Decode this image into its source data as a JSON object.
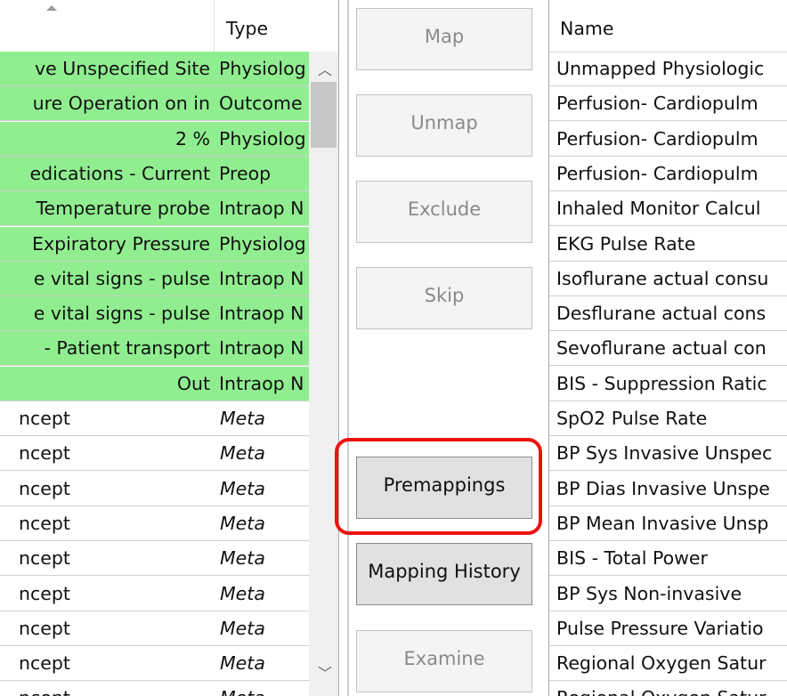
{
  "left_grid": {
    "header": {
      "type_label": "Type"
    },
    "rows": [
      {
        "name": "ve Unspecified Site",
        "type": "Physiolog",
        "mapped": true
      },
      {
        "name": "ure Operation on in",
        "type": "Outcome",
        "mapped": true
      },
      {
        "name": "2 %",
        "type": "Physiolog",
        "mapped": true
      },
      {
        "name": "edications - Current",
        "type": "Preop",
        "mapped": true
      },
      {
        "name": " Temperature probe",
        "type": "Intraop N",
        "mapped": true
      },
      {
        "name": " Expiratory Pressure",
        "type": "Physiolog",
        "mapped": true
      },
      {
        "name": "e vital signs - pulse",
        "type": "Intraop N",
        "mapped": true
      },
      {
        "name": "e vital signs - pulse",
        "type": "Intraop N",
        "mapped": true
      },
      {
        "name": " - Patient transport",
        "type": "Intraop N",
        "mapped": true
      },
      {
        "name": "Out",
        "type": "Intraop N",
        "mapped": true
      },
      {
        "name": "ncept",
        "type": "Meta",
        "mapped": false
      },
      {
        "name": "ncept",
        "type": "Meta",
        "mapped": false
      },
      {
        "name": "ncept",
        "type": "Meta",
        "mapped": false
      },
      {
        "name": "ncept",
        "type": "Meta",
        "mapped": false
      },
      {
        "name": "ncept",
        "type": "Meta",
        "mapped": false
      },
      {
        "name": "ncept",
        "type": "Meta",
        "mapped": false
      },
      {
        "name": "ncept",
        "type": "Meta",
        "mapped": false
      },
      {
        "name": "ncept",
        "type": "Meta",
        "mapped": false
      },
      {
        "name": "ncept",
        "type": "Meta",
        "mapped": false
      }
    ],
    "mapped_color": "#90ee90"
  },
  "buttons": {
    "map": "Map",
    "unmap": "Unmap",
    "exclude": "Exclude",
    "skip": "Skip",
    "premappings": "Premappings",
    "mapping_history": "Mapping History",
    "examine": "Examine"
  },
  "highlight_color": "#ee1111",
  "right_grid": {
    "header": {
      "name_label": "Name"
    },
    "rows": [
      "Unmapped Physiologic",
      "Perfusion- Cardiopulm",
      "Perfusion- Cardiopulm",
      "Perfusion- Cardiopulm",
      "Inhaled Monitor Calcul",
      "EKG Pulse Rate",
      "Isoflurane actual consu",
      "Desflurane actual cons",
      "Sevoflurane actual con",
      "BIS - Suppression Ratic",
      "SpO2 Pulse Rate",
      "BP Sys Invasive Unspec",
      "BP Dias Invasive Unspe",
      "BP Mean Invasive Unsp",
      "BIS - Total Power",
      "BP Sys Non-invasive",
      "Pulse Pressure Variatio",
      "Regional Oxygen Satur",
      "Regional Oxygen Satur"
    ]
  }
}
